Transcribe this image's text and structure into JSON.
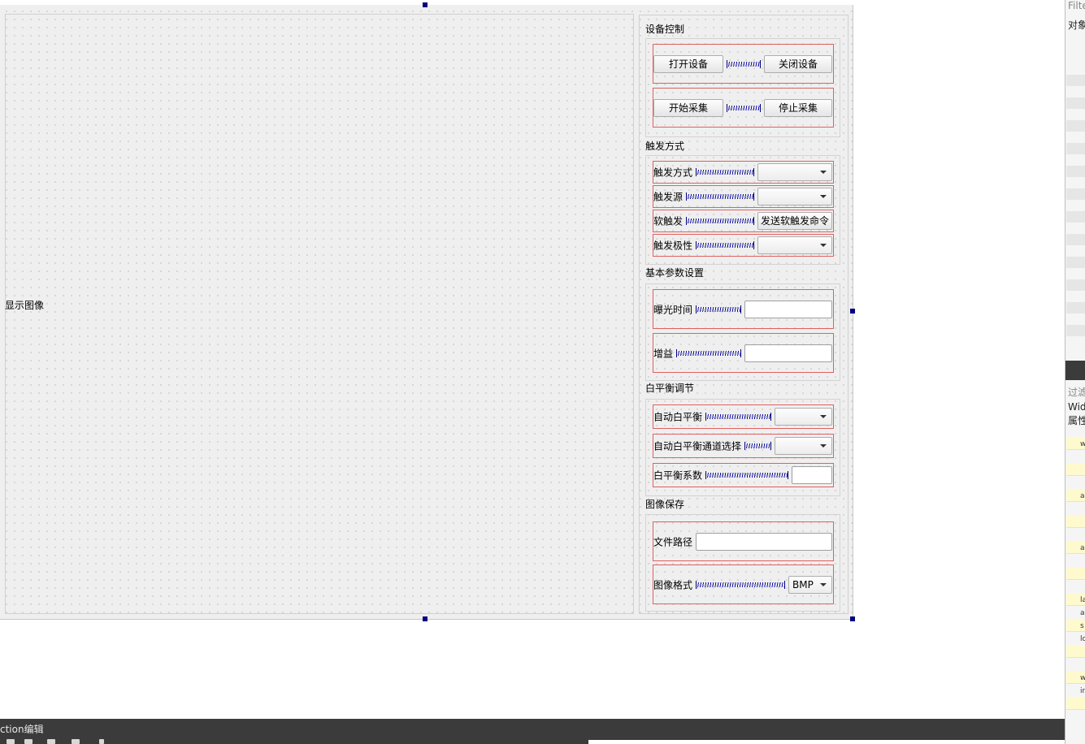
{
  "display": {
    "label": "显示图像"
  },
  "device_control": {
    "title": "设备控制",
    "open_label": "打开设备",
    "close_label": "关闭设备",
    "start_label": "开始采集",
    "stop_label": "停止采集"
  },
  "trigger": {
    "title": "触发方式",
    "mode_label": "触发方式",
    "mode_value": "",
    "source_label": "触发源",
    "source_value": "",
    "soft_label": "软触发",
    "soft_button": "发送软触发命令",
    "polarity_label": "触发极性",
    "polarity_value": ""
  },
  "basic": {
    "title": "基本参数设置",
    "exposure_label": "曝光时间",
    "exposure_value": "",
    "gain_label": "增益",
    "gain_value": ""
  },
  "white_balance": {
    "title": "白平衡调节",
    "auto_label": "自动白平衡",
    "auto_value": "",
    "channel_label": "自动白平衡通道选择",
    "channel_value": "",
    "ratio_label": "白平衡系数",
    "ratio_value": ""
  },
  "image_save": {
    "title": "图像保存",
    "path_label": "文件路径",
    "path_value": "",
    "format_label": "图像格式",
    "format_value": "BMP"
  },
  "bottom": {
    "title": "ction编辑"
  },
  "right_edge": {
    "filter_top": "Filte",
    "object_header": "对象",
    "filter2": "过滤",
    "class_text": "Wid",
    "props_header": "属性",
    "rows": [
      "w",
      "a",
      "a",
      "la",
      "a",
      "s",
      "lo",
      "w",
      "ir"
    ]
  }
}
